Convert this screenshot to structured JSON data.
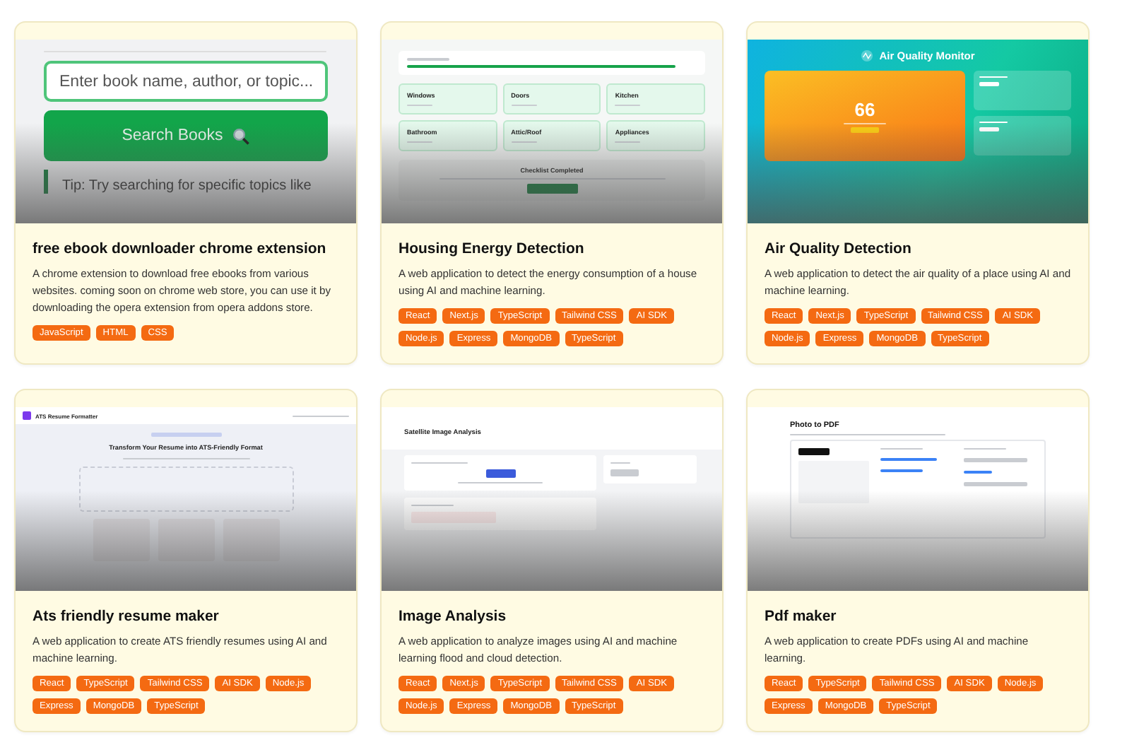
{
  "projects": [
    {
      "title": "free ebook downloader chrome extension",
      "description": "A chrome extension to download free ebooks from various websites. coming soon on chrome web store, you can use it by downloading the opera extension from opera addons store.",
      "tags": [
        "JavaScript",
        "HTML",
        "CSS"
      ],
      "preview": {
        "kind": "ebook",
        "placeholder": "Enter book name, author, or topic...",
        "button": "Search Books",
        "tip": "Tip: Try searching for specific topics like"
      }
    },
    {
      "title": "Housing Energy Detection",
      "description": "A web application to detect the energy consumption of a house using AI and machine learning.",
      "tags": [
        "React",
        "Next.js",
        "TypeScript",
        "Tailwind CSS",
        "AI SDK",
        "Node.js",
        "Express",
        "MongoDB",
        "TypeScript"
      ],
      "preview": {
        "kind": "checklist",
        "items": [
          "Windows",
          "Doors",
          "Kitchen",
          "Bathroom",
          "Attic/Roof",
          "Appliances"
        ],
        "heading": "Checklist Completed"
      }
    },
    {
      "title": "Air Quality Detection",
      "description": "A web application to detect the air quality of a place using AI and machine learning.",
      "tags": [
        "React",
        "Next.js",
        "TypeScript",
        "Tailwind CSS",
        "AI SDK",
        "Node.js",
        "Express",
        "MongoDB",
        "TypeScript"
      ],
      "preview": {
        "kind": "air",
        "heading": "Air Quality Monitor",
        "reading": "66"
      }
    },
    {
      "title": "Ats friendly resume maker",
      "description": "A web application to create ATS friendly resumes using AI and machine learning.",
      "tags": [
        "React",
        "TypeScript",
        "Tailwind CSS",
        "AI SDK",
        "Node.js",
        "Express",
        "MongoDB",
        "TypeScript"
      ],
      "preview": {
        "kind": "resume",
        "brand": "ATS Resume Formatter",
        "heading": "Transform Your Resume into ATS-Friendly Format"
      }
    },
    {
      "title": "Image Analysis",
      "description": "A web application to analyze images using AI and machine learning flood and cloud detection.",
      "tags": [
        "React",
        "Next.js",
        "TypeScript",
        "Tailwind CSS",
        "AI SDK",
        "Node.js",
        "Express",
        "MongoDB",
        "TypeScript"
      ],
      "preview": {
        "kind": "satellite",
        "heading": "Satellite Image Analysis"
      }
    },
    {
      "title": "Pdf maker",
      "description": "A web application to create PDFs using AI and machine learning.",
      "tags": [
        "React",
        "TypeScript",
        "Tailwind CSS",
        "AI SDK",
        "Node.js",
        "Express",
        "MongoDB",
        "TypeScript"
      ],
      "preview": {
        "kind": "pdf",
        "heading": "Photo to PDF"
      }
    }
  ]
}
